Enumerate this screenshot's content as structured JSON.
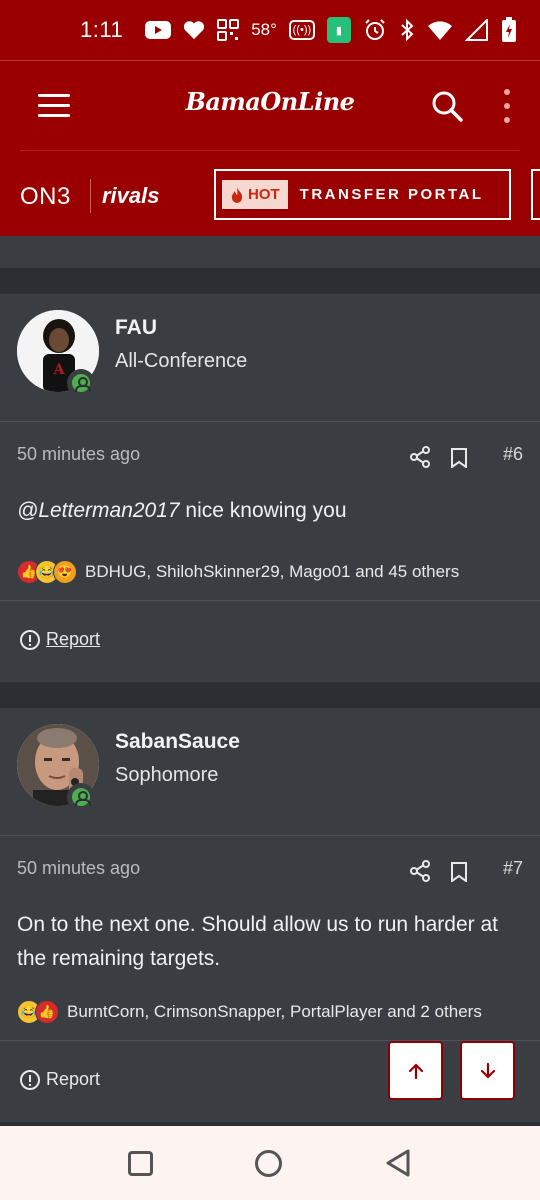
{
  "status_bar": {
    "time": "1:11",
    "temperature": "58°"
  },
  "header": {
    "site_logo": "BamaOnLine",
    "on3_label": "ON3",
    "rivals_label": "rivals",
    "hot_badge": "HOT",
    "transfer_portal_label": "TRANSFER PORTAL"
  },
  "posts": [
    {
      "username": "FAU",
      "user_title": "All-Conference",
      "timestamp": "50 minutes ago",
      "post_number": "#6",
      "mention": "@Letterman2017",
      "message": " nice knowing you",
      "reactions_text": "BDHUG, ShilohSkinner29, Mago01 and 45 others",
      "reaction_icons": [
        "like",
        "laugh",
        "love"
      ],
      "report_label": "Report"
    },
    {
      "username": "SabanSauce",
      "user_title": "Sophomore",
      "timestamp": "50 minutes ago",
      "post_number": "#7",
      "message": "On to the next one. Should allow us to run harder at the remaining targets.",
      "reactions_text": "BurntCorn, CrimsonSnapper, PortalPlayer and 2 others",
      "reaction_icons": [
        "laugh",
        "like"
      ],
      "report_label": "Report"
    }
  ],
  "colors": {
    "brand_red": "#9b0000",
    "card_bg": "#3a3e43",
    "page_bg": "#2b2f33",
    "online_green": "#4cae4c"
  }
}
